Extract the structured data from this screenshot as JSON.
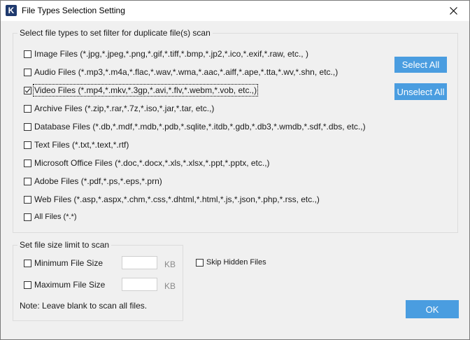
{
  "window": {
    "app_icon_letter": "K",
    "title": "File Types Selection Setting"
  },
  "file_types_group": {
    "legend": "Select file types to set filter for duplicate file(s) scan",
    "items": [
      {
        "label": "Image Files  (*.jpg,*.jpeg,*.png,*.gif,*.tiff,*.bmp,*.jp2,*.ico,*.exif,*.raw, etc., )",
        "checked": false
      },
      {
        "label": "Audio Files (*.mp3,*.m4a,*.flac,*.wav,*.wma,*.aac,*.aiff,*.ape,*.tta,*.wv,*.shn, etc.,)",
        "checked": false
      },
      {
        "label": "Video Files (*.mp4,*.mkv,*.3gp,*.avi,*.flv,*.webm,*.vob, etc.,)",
        "checked": true
      },
      {
        "label": "Archive Files (*.zip,*.rar,*.7z,*.iso,*.jar,*.tar, etc.,)",
        "checked": false
      },
      {
        "label": "Database Files (*.db,*.mdf,*.mdb,*.pdb,*.sqlite,*.itdb,*.gdb,*.db3,*.wmdb,*.sdf,*.dbs, etc.,)",
        "checked": false
      },
      {
        "label": "Text Files (*.txt,*.text,*.rtf)",
        "checked": false
      },
      {
        "label": "Microsoft Office Files (*.doc,*.docx,*.xls,*.xlsx,*.ppt,*.pptx, etc.,)",
        "checked": false
      },
      {
        "label": "Adobe Files (*.pdf,*.ps,*.eps,*.prn)",
        "checked": false
      },
      {
        "label": "Web Files (*.asp,*.aspx,*.chm,*.css,*.dhtml,*.html,*.js,*.json,*.php,*.rss, etc.,)",
        "checked": false
      },
      {
        "label": "All Files (*.*)",
        "checked": false
      }
    ],
    "select_all_label": "Select All",
    "unselect_all_label": "Unselect All"
  },
  "size_group": {
    "legend": "Set file size limit to scan",
    "min_label": "Minimum File Size",
    "max_label": "Maximum File Size",
    "min_value": "",
    "max_value": "",
    "unit": "KB",
    "note": "Note: Leave blank to scan all files."
  },
  "skip_hidden_label": "Skip Hidden Files",
  "ok_label": "OK",
  "colors": {
    "accent": "#4a9de0",
    "title_bar": "#ffffff",
    "background": "#f0f0f0"
  }
}
